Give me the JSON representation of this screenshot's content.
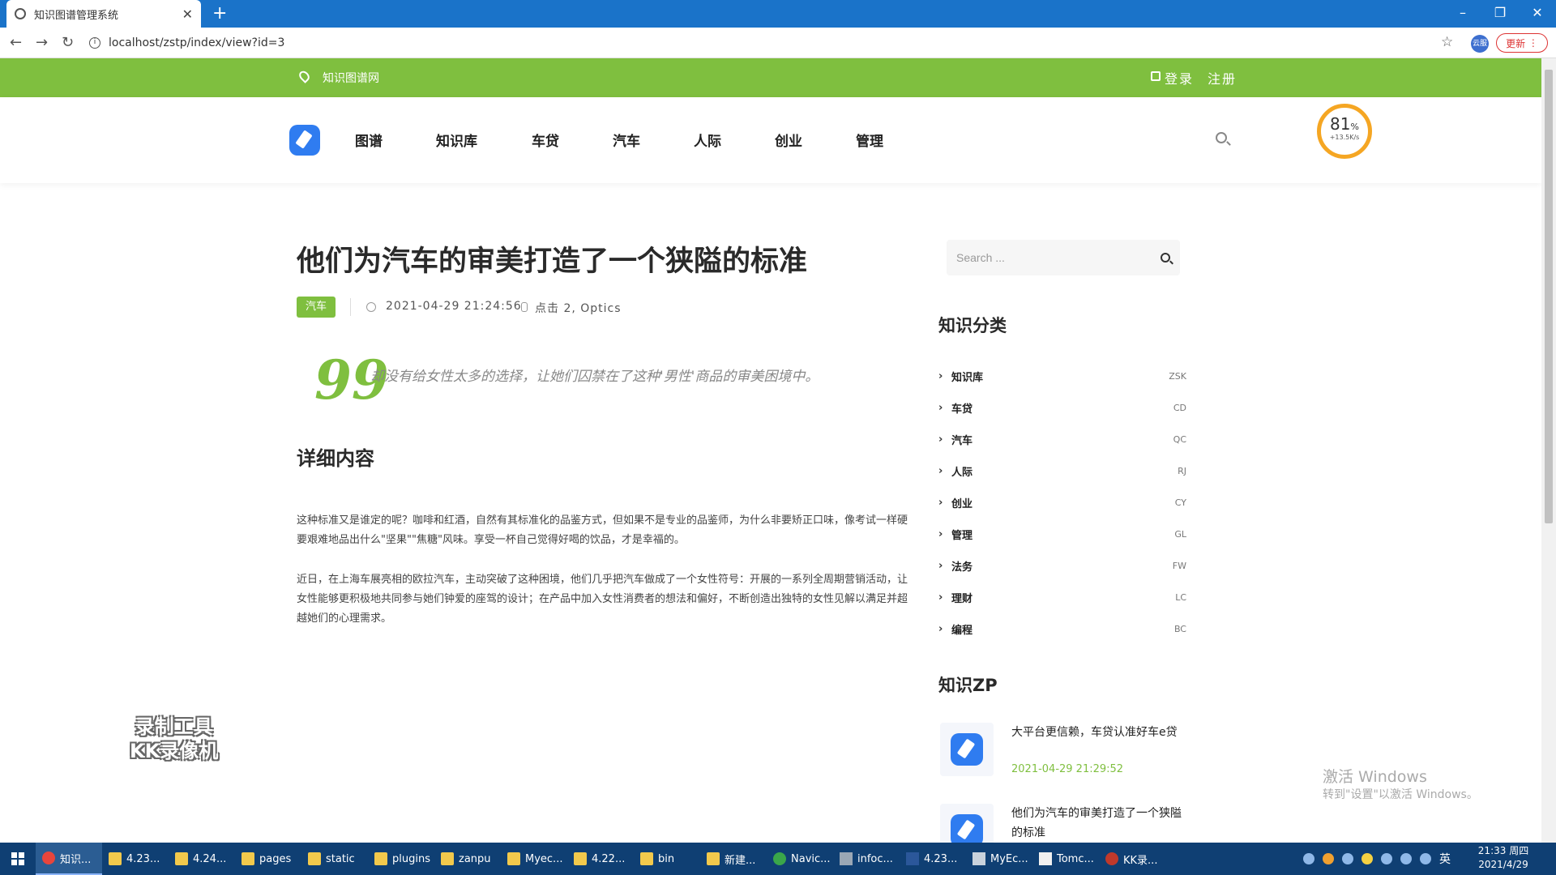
{
  "browser": {
    "tab_title": "知识图谱管理系统",
    "url": "localhost/zstp/index/view?id=3",
    "new_tab": "+",
    "update_label": "更新",
    "ext_label": "云服",
    "minimize": "–",
    "restore": "❐",
    "close": "✕",
    "back": "←",
    "forward": "→",
    "reload": "↻",
    "star": "☆"
  },
  "site_top": {
    "brand": "知识图谱网",
    "login": "登录",
    "register": "注册"
  },
  "nav": {
    "items": [
      "图谱",
      "知识库",
      "车贷",
      "汽车",
      "人际",
      "创业",
      "管理"
    ]
  },
  "gauge": {
    "percent": "81",
    "unit": "%",
    "speed": "+13.5K/s"
  },
  "article": {
    "title": "他们为汽车的审美打造了一个狭隘的标准",
    "tag": "汽车",
    "date": "2021-04-29 21:24:56",
    "hits": "点击 2, Optics",
    "quote_mark": "99",
    "quote": "却没有给女性太多的选择，让她们囚禁在了这种'男性'商品的审美困境中。",
    "section_title": "详细内容",
    "paragraphs": [
      "这种标准又是谁定的呢？咖啡和红酒，自然有其标准化的品鉴方式，但如果不是专业的品鉴师，为什么非要矫正口味，像考试一样硬要艰难地品出什么\"坚果\"\"焦糖\"风味。享受一杯自己觉得好喝的饮品，才是幸福的。",
      "近日，在上海车展亮相的欧拉汽车，主动突破了这种困境，他们几乎把汽车做成了一个女性符号：开展的一系列全周期营销活动，让女性能够更积极地共同参与她们钟爱的座驾的设计；在产品中加入女性消费者的想法和偏好，不断创造出独特的女性见解以满足并超越她们的心理需求。"
    ]
  },
  "sidebar": {
    "search_placeholder": "Search ...",
    "categories_title": "知识分类",
    "categories": [
      {
        "name": "知识库",
        "code": "ZSK"
      },
      {
        "name": "车贷",
        "code": "CD"
      },
      {
        "name": "汽车",
        "code": "QC"
      },
      {
        "name": "人际",
        "code": "RJ"
      },
      {
        "name": "创业",
        "code": "CY"
      },
      {
        "name": "管理",
        "code": "GL"
      },
      {
        "name": "法务",
        "code": "FW"
      },
      {
        "name": "理财",
        "code": "LC"
      },
      {
        "name": "编程",
        "code": "BC"
      }
    ],
    "zp_title": "知识ZP",
    "posts": [
      {
        "title": "大平台更信赖，车贷认准好车e贷",
        "date": "2021-04-29 21:29:52"
      },
      {
        "title": "他们为汽车的审美打造了一个狭隘的标准",
        "date": ""
      }
    ]
  },
  "watermarks": {
    "recorder_line1": "录制工具",
    "recorder_line2": "KK录像机",
    "windows_line1": "激活 Windows",
    "windows_line2": "转到\"设置\"以激活 Windows。"
  },
  "taskbar": {
    "items": [
      "知识...",
      "4.23...",
      "4.24...",
      "pages",
      "static",
      "plugins",
      "zanpu",
      "Myec...",
      "4.22...",
      "bin",
      "新建...",
      "Navic...",
      "infoc...",
      "4.23...",
      "MyEc...",
      "Tomc...",
      "KK录..."
    ],
    "ime": "英",
    "time": "21:33 周四",
    "date": "2021/4/29"
  },
  "colors": {
    "accent_green": "#7fbf3f",
    "brand_blue": "#2f7cf0",
    "tab_bar_blue": "#1a73c9",
    "taskbar": "#0f3f73"
  }
}
